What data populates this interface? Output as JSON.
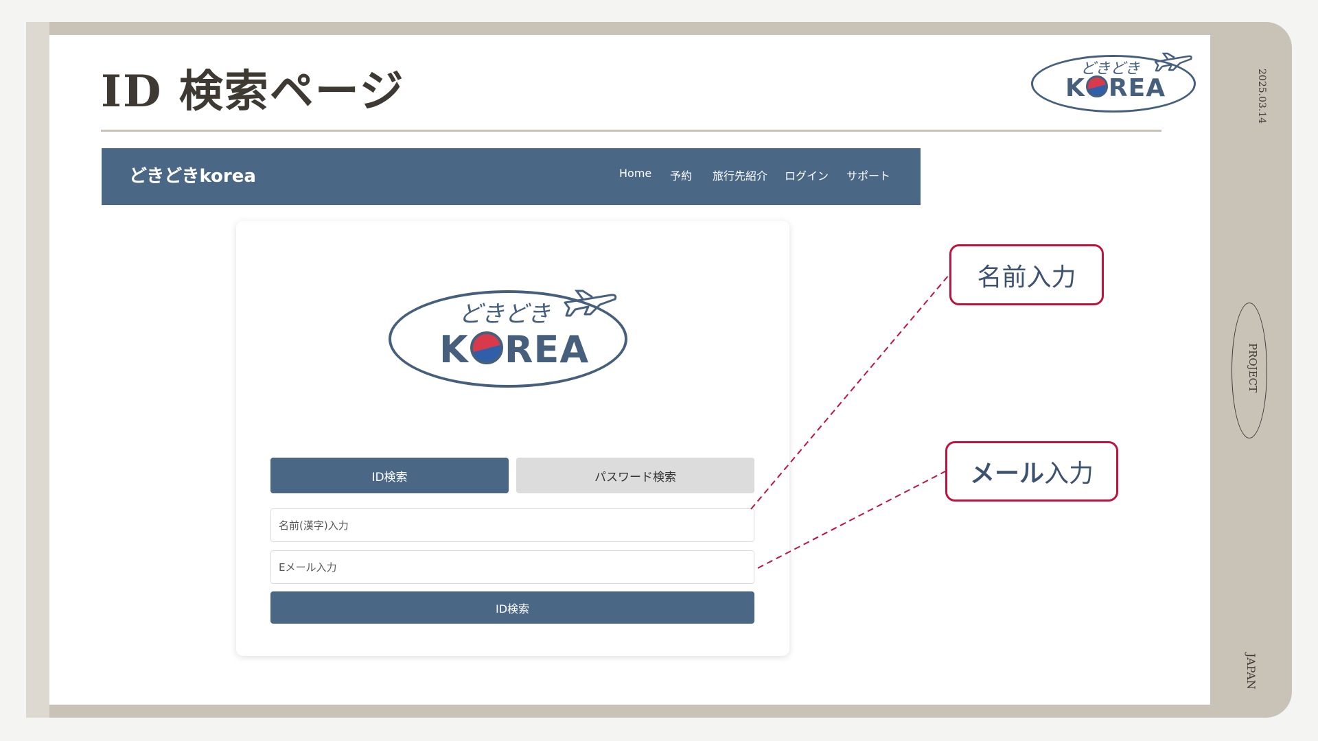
{
  "slide": {
    "title": "ID 検索ページ",
    "date": "2025.03.14",
    "side_label_project": "PROJECT",
    "side_label_japan": "JAPAN"
  },
  "logo": {
    "kana": "どきどき",
    "word": "KOREA",
    "icon": "airplane-icon"
  },
  "navbar": {
    "brand": "どきどきkorea",
    "links": [
      "Home",
      "予約",
      "旅行先紹介",
      "ログイン",
      "サポート"
    ]
  },
  "login_card": {
    "tabs": [
      {
        "label": "ID検索",
        "active": true
      },
      {
        "label": "パスワード検索",
        "active": false
      }
    ],
    "name_field": {
      "placeholder": "名前(漢字)入力",
      "value": ""
    },
    "email_field": {
      "placeholder": "Eメール入力",
      "value": ""
    },
    "submit_label": "ID検索"
  },
  "annotations": {
    "name": "名前入力",
    "email_strong": "メール",
    "email_rest": "入力"
  },
  "colors": {
    "brand_blue": "#4a6886",
    "logo_blue": "#465f7d",
    "callout_red": "#c0123c",
    "frame_taupe": "#c8c2b7",
    "flag_red": "#d83a4b",
    "flag_blue": "#2f5fa8"
  }
}
